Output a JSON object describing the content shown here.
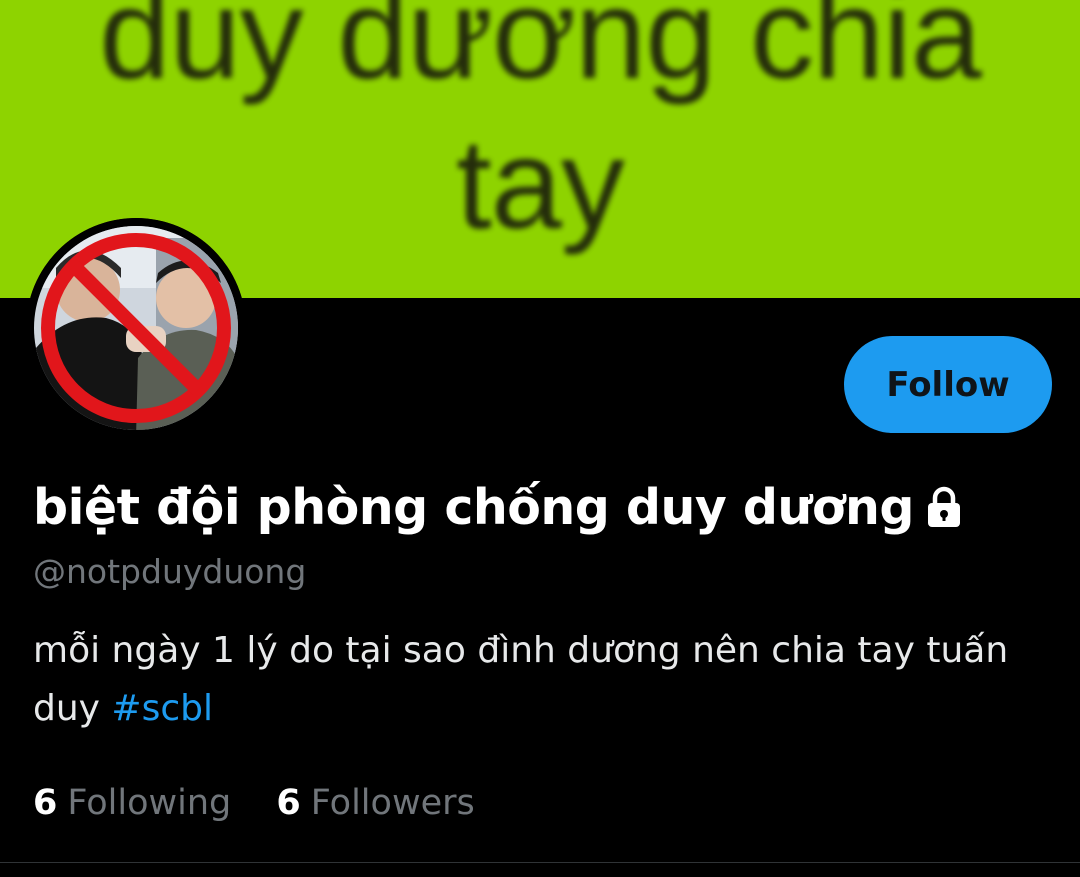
{
  "banner": {
    "text": "duy dương chia tay",
    "background_color": "#8ed300"
  },
  "avatar": {
    "icon": "no-sign-icon"
  },
  "profile": {
    "display_name": "biệt đội phòng chống duy dương",
    "protected_icon": "lock-icon",
    "handle": "@notpduyduong",
    "bio_text": "mỗi ngày 1 lý do tại sao đình dương nên chia tay tuấn duy ",
    "bio_hashtag": "#scbl"
  },
  "follow_button": {
    "label": "Follow",
    "color": "#1d9bf0"
  },
  "stats": {
    "following_count": "6",
    "following_label": "Following",
    "followers_count": "6",
    "followers_label": "Followers"
  }
}
